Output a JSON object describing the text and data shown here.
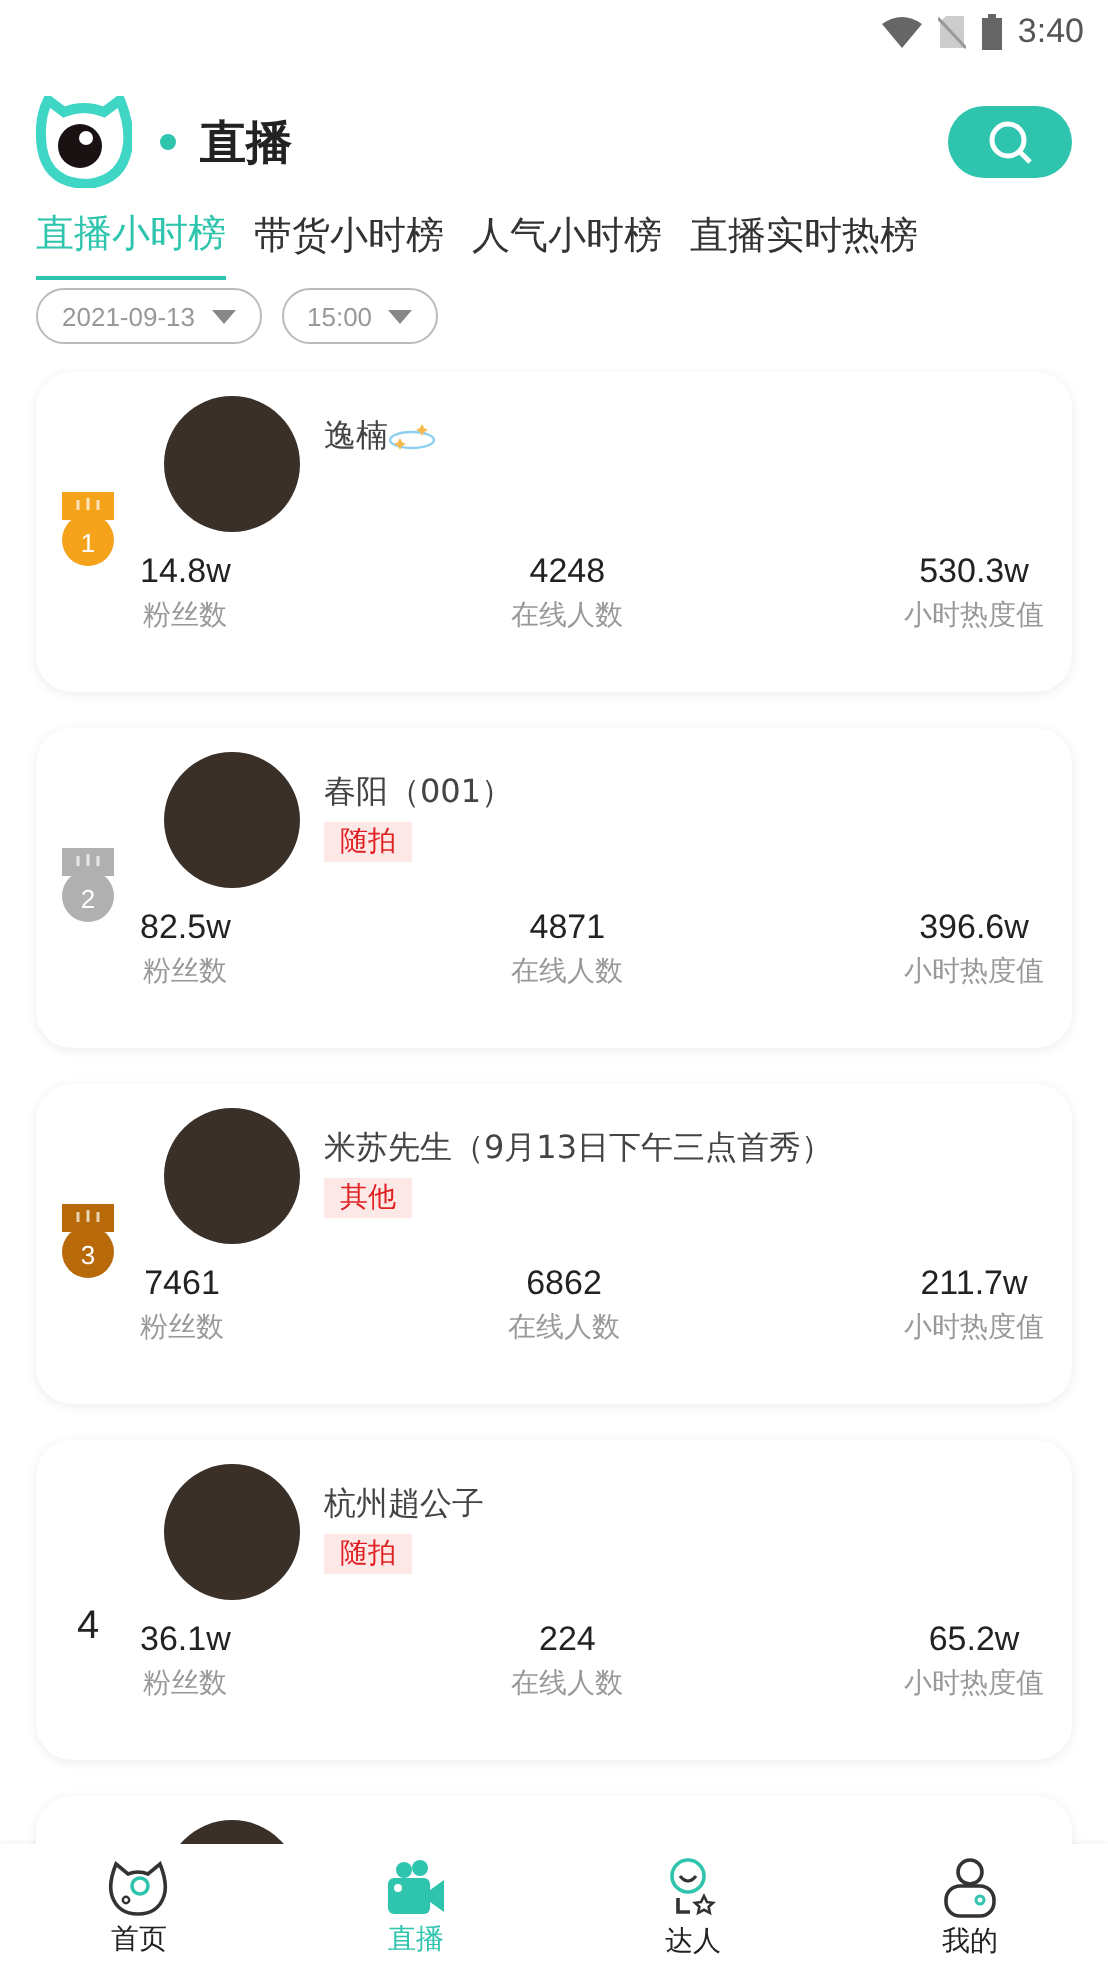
{
  "status_bar": {
    "time": "3:40"
  },
  "header": {
    "title": "直播"
  },
  "tabs": [
    {
      "label": "直播小时榜",
      "selected": true
    },
    {
      "label": "带货小时榜",
      "selected": false
    },
    {
      "label": "人气小时榜",
      "selected": false
    },
    {
      "label": "直播实时热榜",
      "selected": false
    }
  ],
  "filters": [
    {
      "value": "2021-09-13"
    },
    {
      "value": "15:00"
    }
  ],
  "streamers": [
    {
      "rank": "1",
      "kind": "medal",
      "color": "#f5a31a",
      "name": "逸楠",
      "sparkle": true,
      "stats": [
        {
          "value": "14.8w",
          "label": "粉丝数"
        },
        {
          "value": "4248",
          "label": "在线人数"
        },
        {
          "value": "530.3w",
          "label": "小时热度值"
        }
      ]
    },
    {
      "rank": "2",
      "kind": "medal",
      "color": "#b0b0b0",
      "name": "春阳（001）",
      "tag": "随拍",
      "stats": [
        {
          "value": "82.5w",
          "label": "粉丝数"
        },
        {
          "value": "4871",
          "label": "在线人数"
        },
        {
          "value": "396.6w",
          "label": "小时热度值"
        }
      ]
    },
    {
      "rank": "3",
      "kind": "medal",
      "color": "#b8690a",
      "name": "米苏先生（9月13日下午三点首秀）",
      "tag": "其他",
      "stats": [
        {
          "value": "7461",
          "label": "粉丝数"
        },
        {
          "value": "6862",
          "label": "在线人数"
        },
        {
          "value": "211.7w",
          "label": "小时热度值"
        }
      ]
    },
    {
      "rank": "4",
      "kind": "number",
      "name": "杭州趙公子",
      "tag": "随拍",
      "stats": [
        {
          "value": "36.1w",
          "label": "粉丝数"
        },
        {
          "value": "224",
          "label": "在线人数"
        },
        {
          "value": "65.2w",
          "label": "小时热度值"
        }
      ]
    },
    {
      "kind": "partial"
    }
  ],
  "nav": [
    {
      "label": "首页",
      "kind": "home",
      "selected": false
    },
    {
      "label": "直播",
      "kind": "live",
      "selected": true
    },
    {
      "label": "达人",
      "kind": "talent",
      "selected": false
    },
    {
      "label": "我的",
      "kind": "me",
      "selected": false
    }
  ]
}
